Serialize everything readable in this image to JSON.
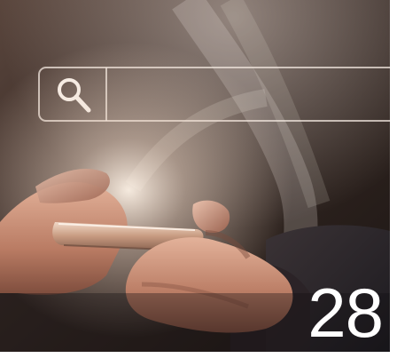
{
  "page": {
    "number": "28"
  },
  "icons": {
    "search": "search-icon"
  },
  "colors": {
    "background_dark": "#2b1f1b",
    "warm_light": "#e9d8c8",
    "skin": "#c98c71",
    "phone_body": "#d8b39a",
    "overlay_line": "#f0e6dd",
    "text": "#ffffff"
  }
}
